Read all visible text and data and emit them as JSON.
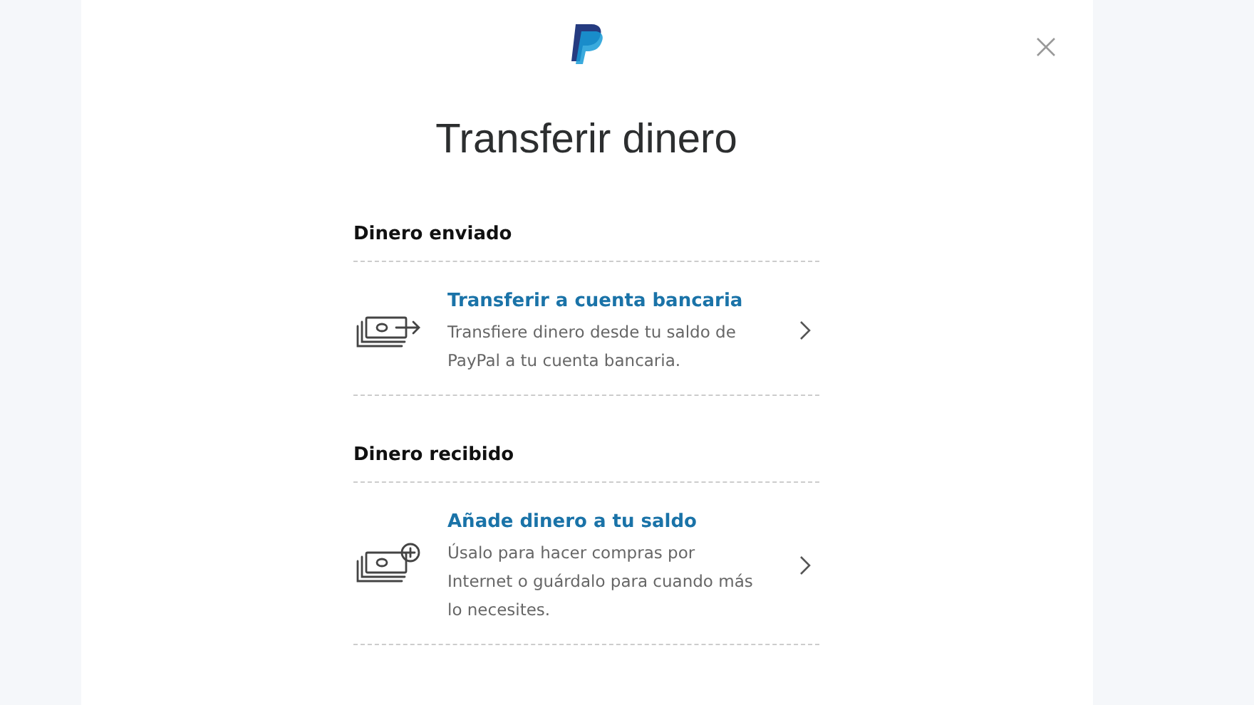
{
  "title": "Transferir dinero",
  "sections": [
    {
      "heading": "Dinero enviado",
      "items": [
        {
          "kind": "transfer",
          "title": "Transferir a cuenta bancaria",
          "description": "Transfiere dinero desde tu saldo de PayPal a tu cuenta bancaria."
        }
      ]
    },
    {
      "heading": "Dinero recibido",
      "items": [
        {
          "kind": "add",
          "title": "Añade dinero a tu saldo",
          "description": "Úsalo para hacer compras por Internet o guárdalo para cuando más lo necesites."
        }
      ]
    }
  ]
}
